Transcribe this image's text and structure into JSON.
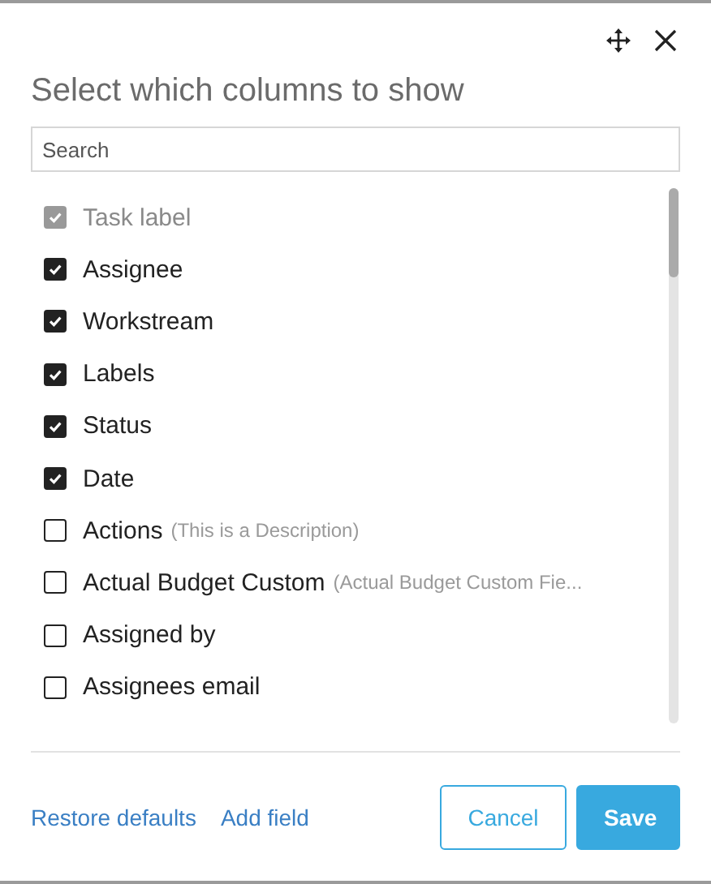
{
  "dialog": {
    "title": "Select which columns to show"
  },
  "search": {
    "placeholder": "Search"
  },
  "columns": [
    {
      "label": "Task label",
      "checked": true,
      "disabled": true
    },
    {
      "label": "Assignee",
      "checked": true,
      "disabled": false
    },
    {
      "label": "Workstream",
      "checked": true,
      "disabled": false
    },
    {
      "label": "Labels",
      "checked": true,
      "disabled": false
    },
    {
      "label": "Status",
      "checked": true,
      "disabled": false
    },
    {
      "label": "Date",
      "checked": true,
      "disabled": false
    },
    {
      "label": "Actions",
      "description": "(This is a Description)",
      "checked": false,
      "disabled": false
    },
    {
      "label": "Actual Budget Custom",
      "description": "(Actual Budget Custom Fie...",
      "checked": false,
      "disabled": false
    },
    {
      "label": "Assigned by",
      "checked": false,
      "disabled": false
    },
    {
      "label": "Assignees email",
      "checked": false,
      "disabled": false
    }
  ],
  "links": [
    "Restore defaults",
    "Add field"
  ],
  "buttons": [
    {
      "label": "Cancel",
      "kind": "secondary"
    },
    {
      "label": "Save",
      "kind": "primary"
    }
  ]
}
